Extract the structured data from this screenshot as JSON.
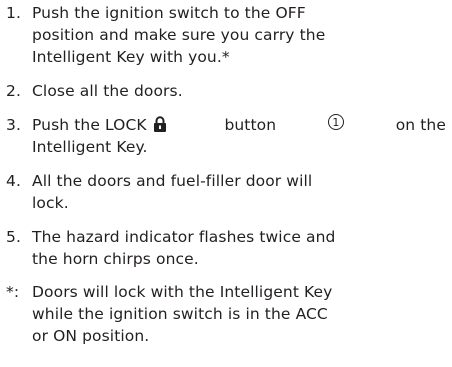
{
  "steps": [
    {
      "number": "1.",
      "lines": [
        "Push the ignition switch to the OFF",
        "position and make sure you carry the",
        "Intelligent Key with you.*"
      ]
    },
    {
      "number": "2.",
      "lines": [
        "Close all the doors."
      ]
    },
    {
      "number": "3.",
      "line1_before": "Push the LOCK",
      "lock_icon": "padlock-icon",
      "line1_after": "button",
      "callout": "1",
      "line1_end": "on the",
      "line2": "Intelligent Key."
    },
    {
      "number": "4.",
      "lines": [
        "All the doors and fuel-filler door will",
        "lock."
      ]
    },
    {
      "number": "5.",
      "lines": [
        "The hazard indicator flashes twice and",
        "the horn chirps once."
      ]
    }
  ],
  "footnote": {
    "marker": "*:",
    "lines": [
      "Doors will lock with the Intelligent Key",
      "while the ignition switch is in the ACC",
      "or ON position."
    ]
  }
}
